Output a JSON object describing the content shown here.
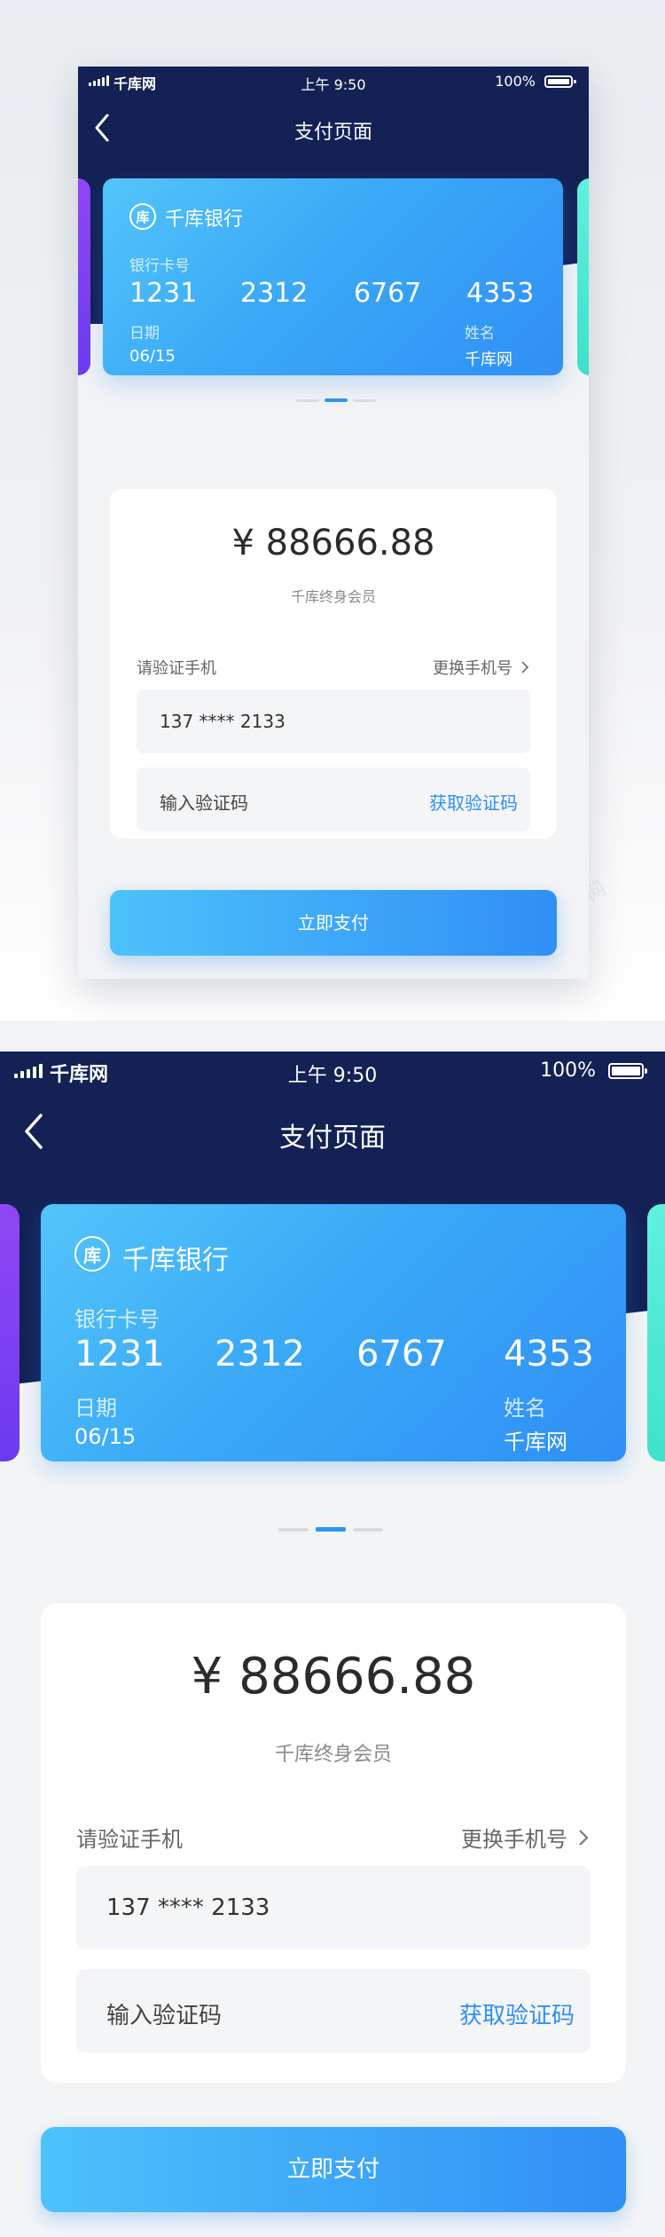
{
  "status_bar": {
    "carrier": "千库网",
    "time": "上午 9:50",
    "battery_pct": "100%"
  },
  "nav": {
    "title": "支付页面"
  },
  "card": {
    "bank_name": "千库银行",
    "logo_char": "库",
    "number_label": "银行卡号",
    "number_groups": [
      "1231",
      "2312",
      "6767",
      "4353"
    ],
    "date_label": "日期",
    "date_value": "06/15",
    "name_label": "姓名",
    "name_value": "千库网"
  },
  "payment": {
    "amount": "¥ 88666.88",
    "member_type": "千库终身会员",
    "verify_phone_label": "请验证手机",
    "change_phone_label": "更换手机号",
    "phone_value": "137 **** 2133",
    "code_placeholder": "输入验证码",
    "get_code_label": "获取验证码",
    "pay_label": "立即支付"
  },
  "watermark_text": "千库网",
  "colors": {
    "navy": "#132155",
    "accent_blue": "#2f8ff5",
    "card_gradient_start": "#53c5fa",
    "card_gradient_end": "#2f8ff5",
    "side_card_left": "#7b3ff2",
    "side_card_right": "#4ee8d3"
  }
}
